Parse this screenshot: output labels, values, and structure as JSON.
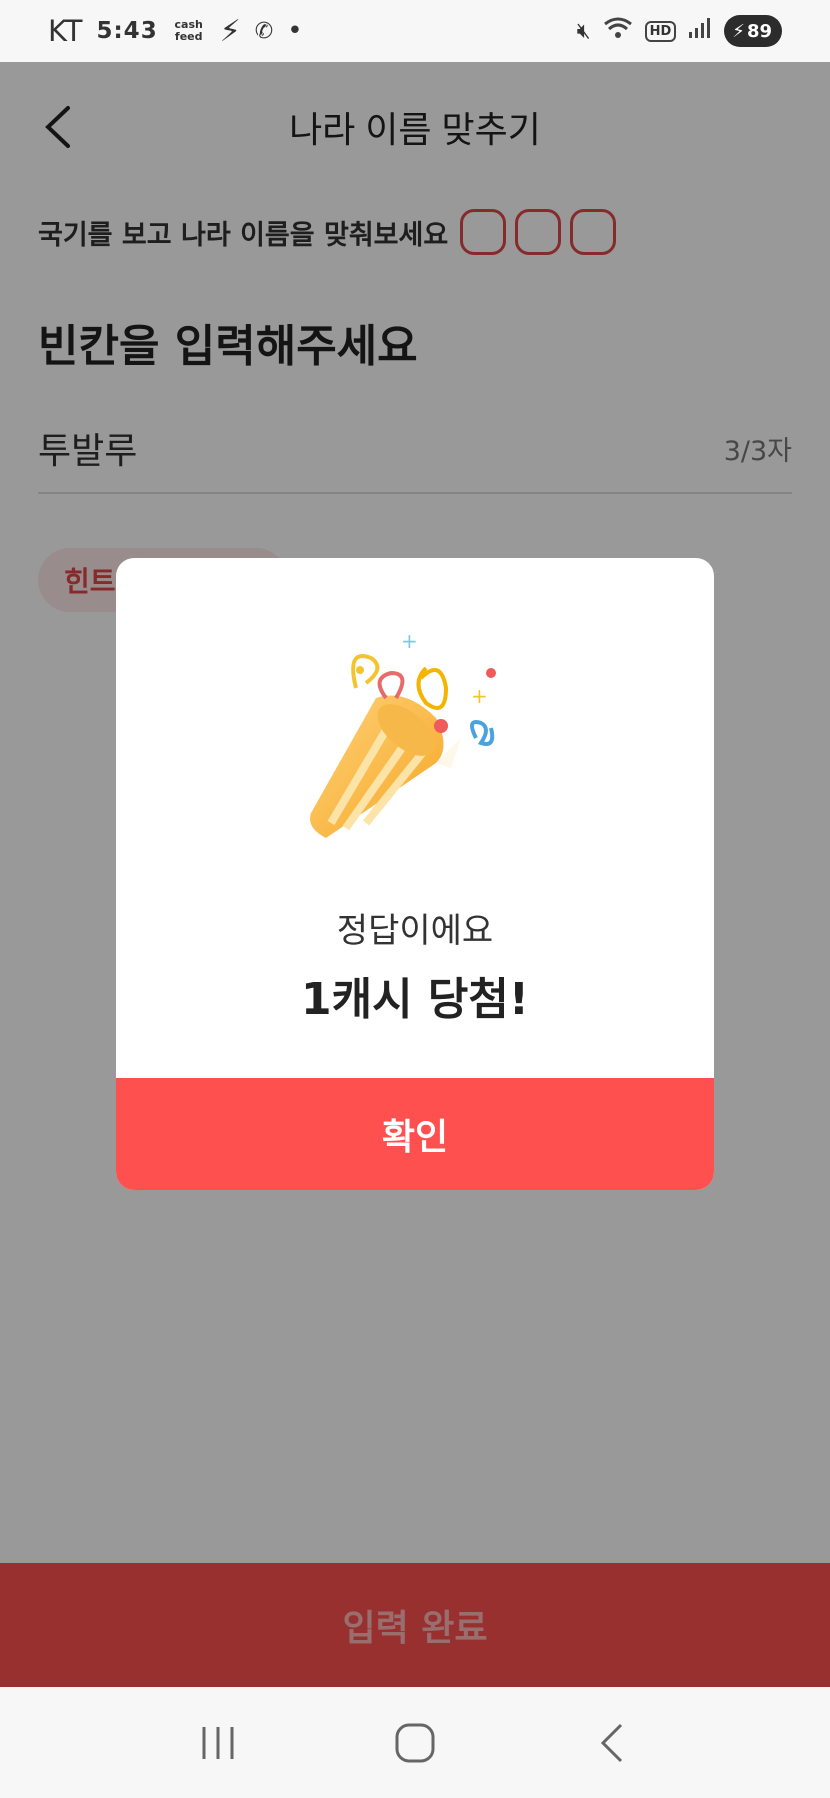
{
  "status_bar": {
    "carrier": "KT",
    "time": "5:43",
    "app_badge_top": "cash",
    "app_badge_bottom": "feed",
    "battery": "89"
  },
  "header": {
    "title": "나라 이름 맞추기"
  },
  "instruction": {
    "text": "국기를 보고  나라 이름을 맞춰보세요",
    "blank_count": 3
  },
  "prompt": "빈칸을 입력해주세요",
  "answer": {
    "value": "투발루",
    "counter": "3/3자"
  },
  "hint": {
    "label": "힌트"
  },
  "submit": {
    "label": "입력 완료"
  },
  "modal": {
    "message": "정답이에요",
    "prize": "1캐시 당첨!",
    "confirm_label": "확인",
    "art_icon": "party-popper-icon"
  },
  "colors": {
    "accent": "#ff5050",
    "blank_border": "#e04848"
  }
}
